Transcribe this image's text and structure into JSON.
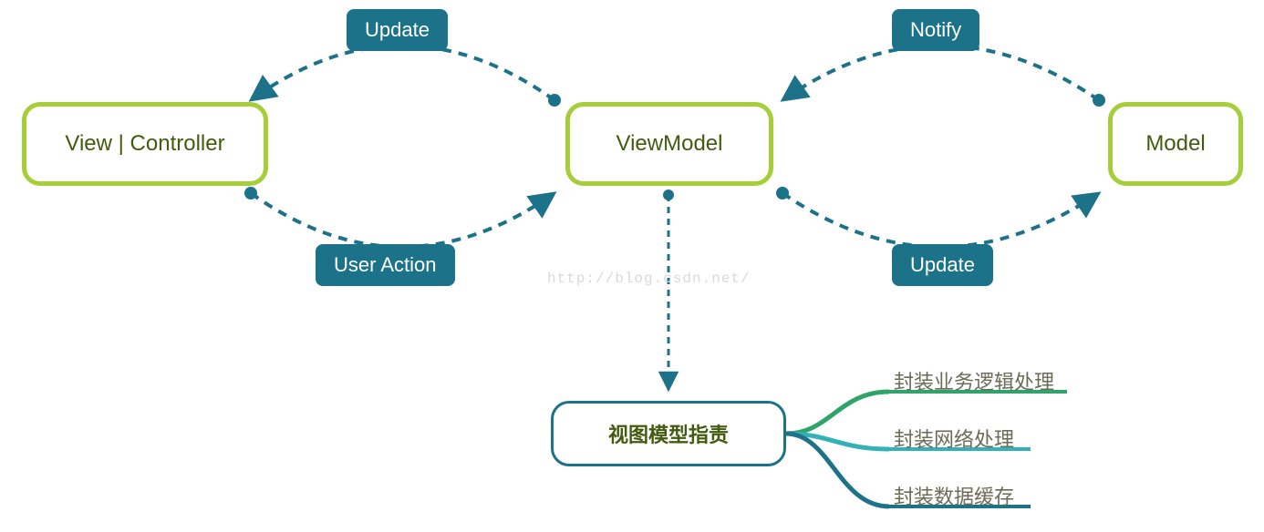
{
  "nodes": {
    "view": "View | Controller",
    "viewmodel": "ViewModel",
    "model": "Model"
  },
  "labels": {
    "update_left": "Update",
    "user_action": "User Action",
    "notify": "Notify",
    "update_right": "Update"
  },
  "responsibility": {
    "title": "视图模型指责",
    "items": [
      "封装业务逻辑处理",
      "封装网络处理",
      "封装数据缓存"
    ]
  },
  "watermark": "http://blog.csdn.net/",
  "colors": {
    "node_border": "#a6ce39",
    "label_bg": "#1c7389",
    "arc_stroke": "#1c7389",
    "branch1": "#2ea46a",
    "branch2": "#34b1b8",
    "branch3": "#1c7389"
  }
}
